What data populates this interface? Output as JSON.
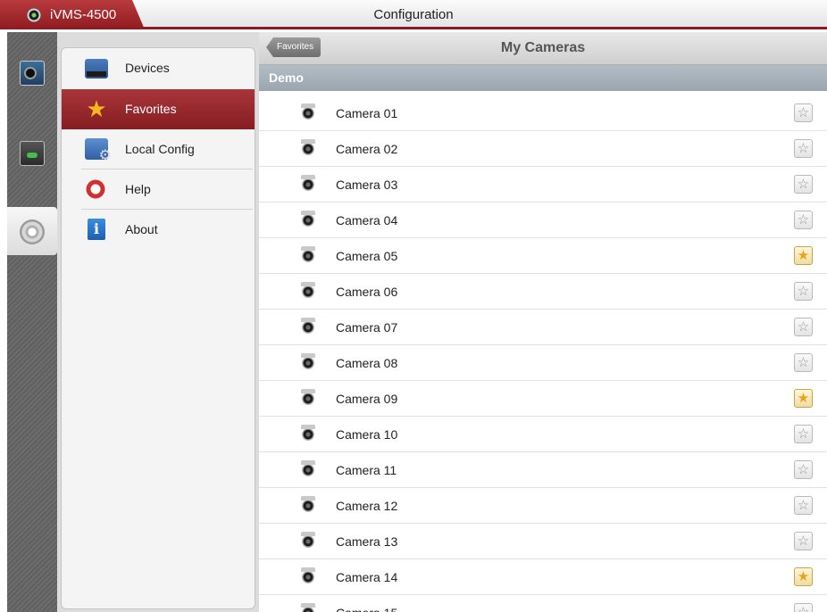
{
  "app": {
    "name": "iVMS-4500",
    "window_title": "Configuration"
  },
  "rail": [
    {
      "id": "live",
      "icon": "live-view-icon"
    },
    {
      "id": "playback",
      "icon": "playback-icon"
    },
    {
      "id": "config",
      "icon": "settings-gear-icon",
      "selected": true
    }
  ],
  "menu": {
    "items": [
      {
        "label": "Devices",
        "icon": "devices-icon"
      },
      {
        "label": "Favorites",
        "icon": "star-icon",
        "selected": true
      },
      {
        "label": "Local Config",
        "icon": "local-config-icon"
      },
      {
        "label": "Help",
        "icon": "lifebuoy-icon"
      },
      {
        "label": "About",
        "icon": "info-icon"
      }
    ]
  },
  "content": {
    "back_label": "Favorites",
    "title": "My Cameras",
    "group": "Demo",
    "cameras": [
      {
        "name": "Camera 01",
        "favorite": false
      },
      {
        "name": "Camera 02",
        "favorite": false
      },
      {
        "name": "Camera 03",
        "favorite": false
      },
      {
        "name": "Camera 04",
        "favorite": false
      },
      {
        "name": "Camera 05",
        "favorite": true
      },
      {
        "name": "Camera 06",
        "favorite": false
      },
      {
        "name": "Camera 07",
        "favorite": false
      },
      {
        "name": "Camera 08",
        "favorite": false
      },
      {
        "name": "Camera 09",
        "favorite": true
      },
      {
        "name": "Camera 10",
        "favorite": false
      },
      {
        "name": "Camera 11",
        "favorite": false
      },
      {
        "name": "Camera 12",
        "favorite": false
      },
      {
        "name": "Camera 13",
        "favorite": false
      },
      {
        "name": "Camera 14",
        "favorite": true
      },
      {
        "name": "Camera 15",
        "favorite": false
      }
    ]
  },
  "colors": {
    "accent": "#8e1a1f",
    "favorite_on": "#e8a318"
  }
}
